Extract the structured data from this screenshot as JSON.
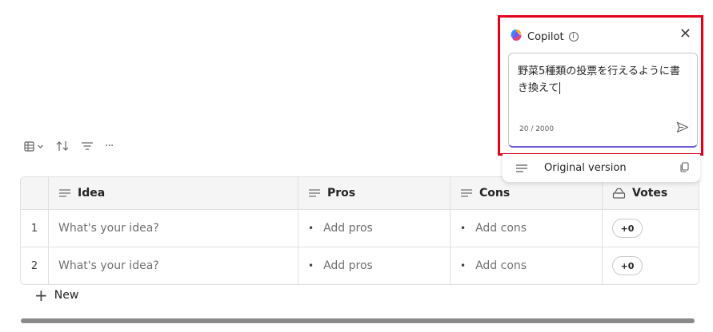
{
  "toolbar": {
    "icons": [
      "table-view-icon",
      "chevron-down-icon",
      "sort-icon",
      "filter-icon",
      "more-icon"
    ],
    "more_label": "···"
  },
  "table": {
    "columns": [
      {
        "label": "Idea",
        "icon": "text-lines-icon"
      },
      {
        "label": "Pros",
        "icon": "text-lines-icon"
      },
      {
        "label": "Cons",
        "icon": "text-lines-icon"
      },
      {
        "label": "Votes",
        "icon": "vote-icon"
      }
    ],
    "rows": [
      {
        "num": "1",
        "idea": "What's your idea?",
        "pros": "Add pros",
        "cons": "Add cons",
        "votes": "+0"
      },
      {
        "num": "2",
        "idea": "What's your idea?",
        "pros": "Add pros",
        "cons": "Add cons",
        "votes": "+0"
      }
    ],
    "bullet": "•",
    "new_label": "New",
    "new_plus": "+"
  },
  "copilot": {
    "title": "Copilot",
    "info": "i",
    "close": "✕",
    "input_value": "野菜5種類の投票を行えるように書き換えて",
    "char_count": "20 / 2000",
    "original_label": "Original version",
    "accent": "#6b5bd6",
    "highlight": "#e3001b"
  }
}
